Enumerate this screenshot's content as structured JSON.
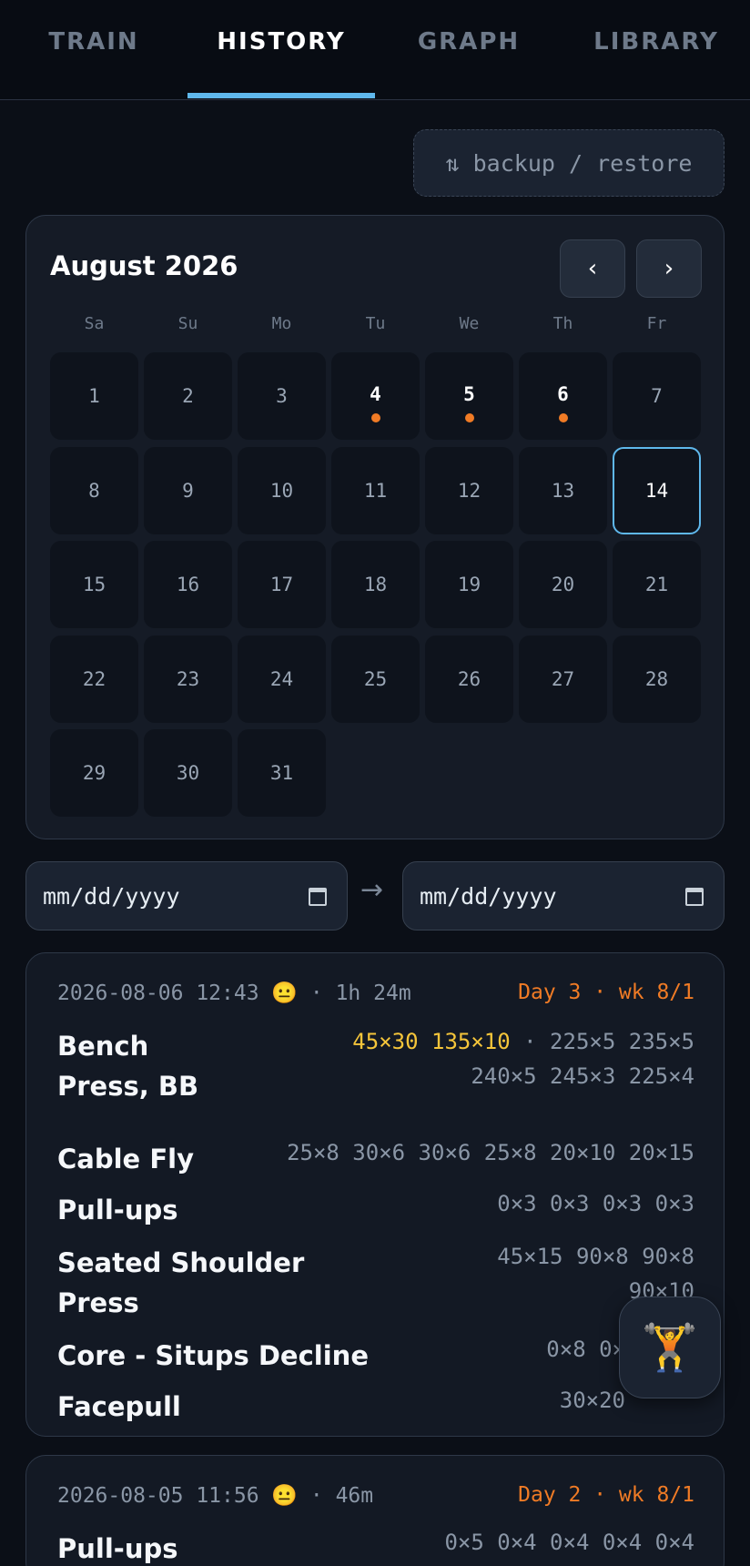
{
  "tabs": [
    {
      "label": "TRAIN"
    },
    {
      "label": "HISTORY"
    },
    {
      "label": "GRAPH"
    },
    {
      "label": "LIBRARY"
    }
  ],
  "active_tab": "HISTORY",
  "backup_label": "⇅ backup / restore",
  "calendar": {
    "title": "August 2026",
    "prev_label": "‹",
    "next_label": "›",
    "weekdays": [
      "Sa",
      "Su",
      "Mo",
      "Tu",
      "We",
      "Th",
      "Fr"
    ],
    "days": [
      "1",
      "2",
      "3",
      "4",
      "5",
      "6",
      "7",
      "8",
      "9",
      "10",
      "11",
      "12",
      "13",
      "14",
      "15",
      "16",
      "17",
      "18",
      "19",
      "20",
      "21",
      "22",
      "23",
      "24",
      "25",
      "26",
      "27",
      "28",
      "29",
      "30",
      "31"
    ],
    "workout_days": [
      "4",
      "5",
      "6"
    ],
    "today": "14"
  },
  "date_range": {
    "from": "mm/dd/yyyy",
    "arrow": "→",
    "to": "mm/dd/yyyy"
  },
  "workouts": [
    {
      "meta": "2026-08-06 12:43 😐 · 1h 24m",
      "day_label": "Day 3 · wk 8/1",
      "exercises": [
        {
          "name_lines": [
            "Bench",
            "Press, BB"
          ],
          "warmup": "45×30 135×10",
          "sep": " · ",
          "set_lines": [
            "225×5 235×5",
            "240×5 245×3 225×4"
          ]
        },
        {
          "name_lines": [
            "Cable Fly"
          ],
          "set_lines": [
            "25×8 30×6 30×6 25×8 20×10 20×15"
          ]
        },
        {
          "name_lines": [
            "Pull-ups"
          ],
          "set_lines": [
            "0×3 0×3 0×3 0×3"
          ]
        },
        {
          "name_lines": [
            "Seated Shoulder",
            "Press"
          ],
          "set_lines": [
            "45×15 90×8 90×8",
            "90×10"
          ]
        },
        {
          "name_lines": [
            "Core - Situps Decline"
          ],
          "set_lines": [
            "0×8 0×"
          ]
        },
        {
          "name_lines": [
            "Facepull"
          ],
          "set_lines": [
            "30×20"
          ]
        }
      ]
    },
    {
      "meta": "2026-08-05 11:56 😐 · 46m",
      "day_label": "Day 2 · wk 8/1",
      "exercises": [
        {
          "name_lines": [
            "Pull-ups"
          ],
          "set_lines": [
            "0×5 0×4 0×4 0×4 0×4"
          ]
        }
      ]
    }
  ],
  "fab_icon": "🏋️",
  "colors": {
    "accent": "#5fb8ec",
    "workout_dot": "#f07b25",
    "warmup": "#f5c53a"
  }
}
